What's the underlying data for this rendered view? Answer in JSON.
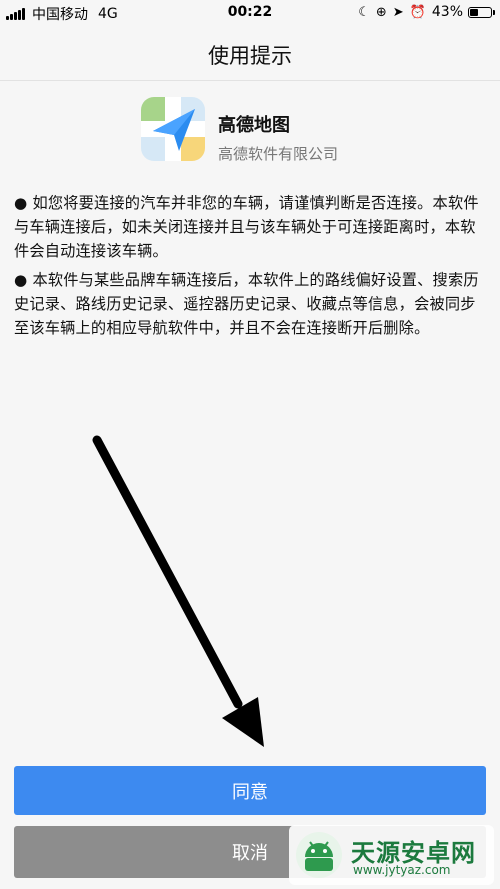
{
  "status_bar": {
    "carrier": "中国移动",
    "network": "4G",
    "time": "00:22",
    "battery": "43%",
    "battery_level": 0.43,
    "icons": [
      "moon-icon",
      "rotation-lock-icon",
      "location-icon",
      "alarm-icon"
    ]
  },
  "header": {
    "title": "使用提示"
  },
  "app": {
    "name": "高德地图",
    "company": "高德软件有限公司"
  },
  "notice": {
    "paragraph1": "● 如您将要连接的汽车并非您的车辆，请谨慎判断是否连接。本软件与车辆连接后，如未关闭连接并且与该车辆处于可连接距离时，本软件会自动连接该车辆。",
    "paragraph2": "● 本软件与某些品牌车辆连接后，本软件上的路线偏好设置、搜索历史记录、路线历史记录、遥控器历史记录、收藏点等信息，会被同步至该车辆上的相应导航软件中，并且不会在连接断开后删除。"
  },
  "buttons": {
    "agree": "同意",
    "cancel": "取消"
  },
  "watermark": {
    "title": "天源安卓网",
    "url": "www.jytyaz.com"
  },
  "colors": {
    "agree": "#3d8af0",
    "cancel": "#8d8d8d",
    "watermark": "#1c7a3e"
  }
}
